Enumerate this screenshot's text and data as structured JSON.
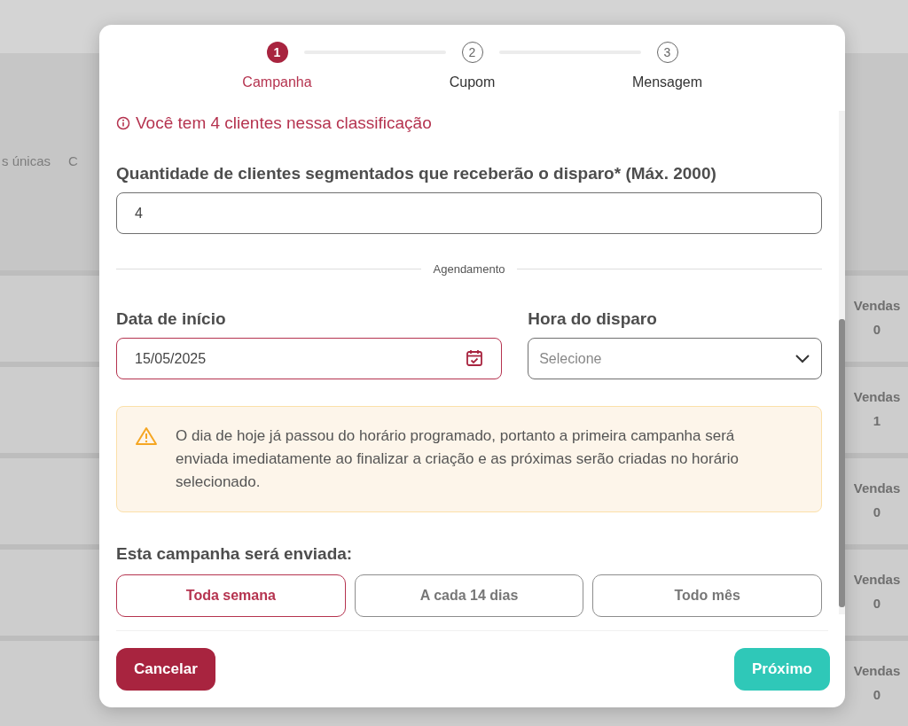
{
  "background": {
    "header_texts": [
      "s únicas",
      "C"
    ],
    "rows": [
      {
        "label": "Vendas",
        "value": "0"
      },
      {
        "label": "Vendas",
        "value": "1"
      },
      {
        "label": "Vendas",
        "value": "0"
      },
      {
        "label": "Vendas",
        "value": "0"
      },
      {
        "label": "Vendas",
        "value": "0"
      }
    ]
  },
  "modal": {
    "steps": [
      {
        "number": "1",
        "label": "Campanha",
        "selected": true
      },
      {
        "number": "2",
        "label": "Cupom",
        "selected": false
      },
      {
        "number": "3",
        "label": "Mensagem",
        "selected": false
      }
    ],
    "info": "Você tem 4 clientes nessa classificação",
    "quantity": {
      "label": "Quantidade de clientes segmentados que receberão o disparo* (Máx. 2000)",
      "value": "4"
    },
    "divider_label": "Agendamento",
    "start_date": {
      "label": "Data de início",
      "value": "15/05/2025"
    },
    "send_time": {
      "label": "Hora do disparo",
      "placeholder": "Selecione"
    },
    "warning": "O dia de hoje já passou do horário programado, portanto a primeira campanha será enviada imediatamente ao finalizar a criação e as próximas serão criadas no horário selecionado.",
    "frequency": {
      "label": "Esta campanha será enviada:",
      "options": [
        {
          "label": "Toda semana",
          "selected": true
        },
        {
          "label": "A cada 14 dias",
          "selected": false
        },
        {
          "label": "Todo mês",
          "selected": false
        }
      ]
    },
    "buttons": [
      {
        "label": "Cancelar",
        "kind": "cancel"
      },
      {
        "label": "Próximo",
        "kind": "next"
      }
    ]
  }
}
